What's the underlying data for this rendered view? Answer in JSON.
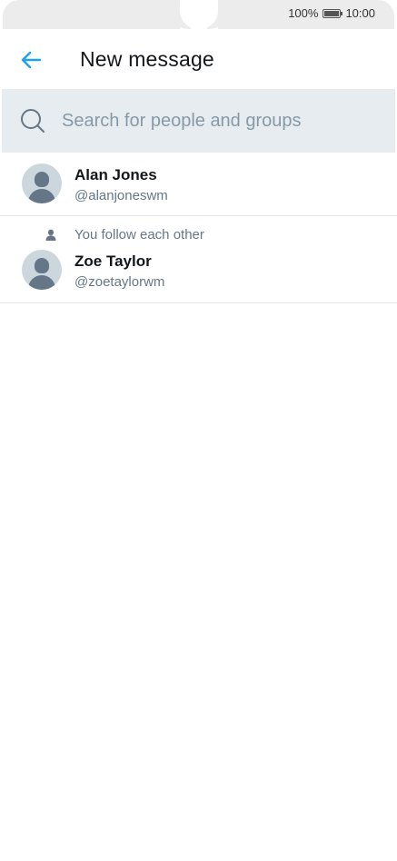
{
  "status_bar": {
    "battery_percent": "100%",
    "time": "10:00"
  },
  "header": {
    "title": "New message",
    "back_icon": "arrow-left-icon",
    "accent_color": "#1da1f2"
  },
  "search": {
    "placeholder": "Search for people and groups",
    "value": "",
    "icon": "search-icon"
  },
  "contacts": [
    {
      "name": "Alan Jones",
      "handle": "@alanjoneswm",
      "note": ""
    },
    {
      "name": "Zoe Taylor",
      "handle": "@zoetaylorwm",
      "note": "You follow each other"
    }
  ]
}
